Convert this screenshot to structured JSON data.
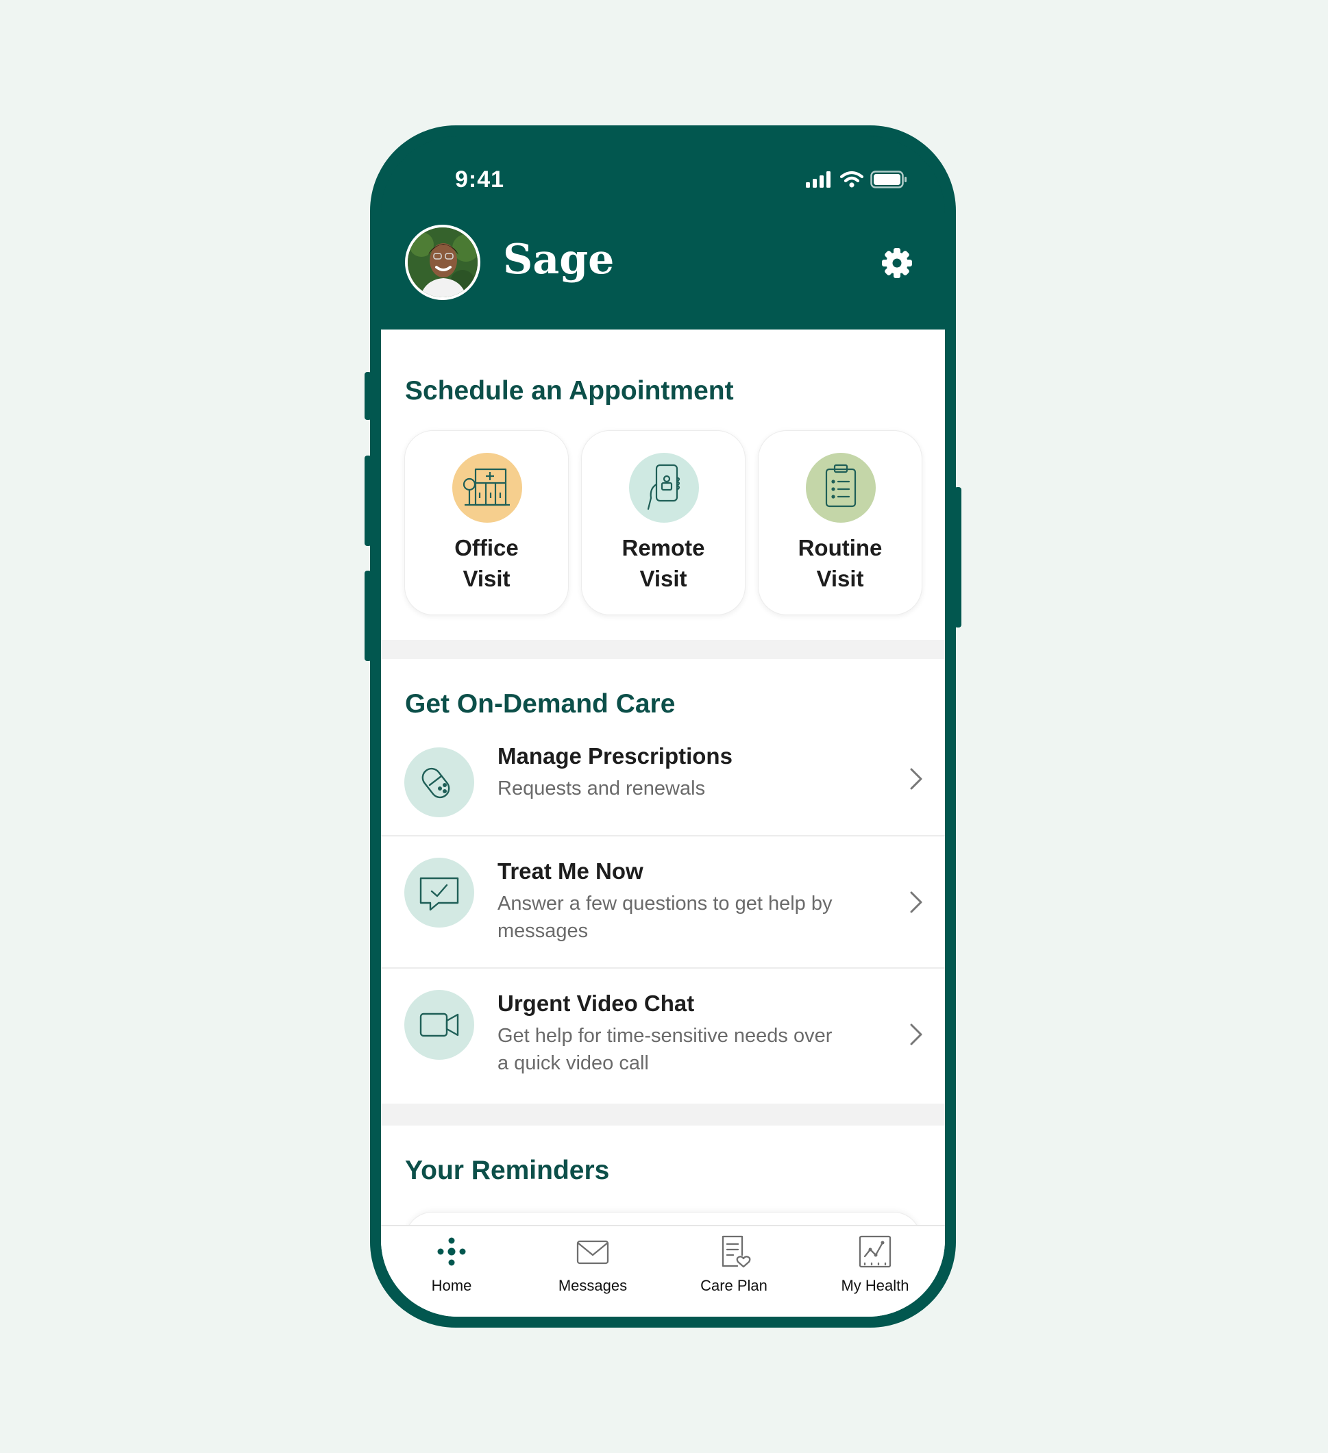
{
  "status_bar": {
    "time": "9:41"
  },
  "header": {
    "title": "Sage",
    "avatar_alt": "user avatar"
  },
  "schedule": {
    "title": "Schedule an Appointment",
    "cards": [
      {
        "label_line1": "Office",
        "label_line2": "Visit",
        "icon": "office-building-icon",
        "icon_bg": "#f6cf8e"
      },
      {
        "label_line1": "Remote",
        "label_line2": "Visit",
        "icon": "phone-hand-icon",
        "icon_bg": "#cfe9e2"
      },
      {
        "label_line1": "Routine",
        "label_line2": "Visit",
        "icon": "clipboard-icon",
        "icon_bg": "#c4d6a8"
      }
    ]
  },
  "on_demand": {
    "title": "Get On-Demand Care",
    "items": [
      {
        "title": "Manage Prescriptions",
        "subtitle": "Requests and renewals",
        "icon": "pill-icon"
      },
      {
        "title": "Treat Me Now",
        "subtitle": "Answer a few questions to get help by messages",
        "icon": "chat-check-icon"
      },
      {
        "title": "Urgent Video Chat",
        "subtitle": "Get help for time-sensitive needs over a quick video call",
        "icon": "video-camera-icon"
      }
    ]
  },
  "reminders": {
    "title": "Your Reminders"
  },
  "tabbar": {
    "tabs": [
      {
        "label": "Home",
        "icon": "home-dots-icon",
        "active": true
      },
      {
        "label": "Messages",
        "icon": "envelope-icon",
        "active": false
      },
      {
        "label": "Care Plan",
        "icon": "care-plan-icon",
        "active": false
      },
      {
        "label": "My Health",
        "icon": "chart-icon",
        "active": false
      }
    ]
  },
  "colors": {
    "brand": "#02574f",
    "heading": "#0c4f49",
    "icon_teal": "#1f6b61",
    "chip_bg": "#d3e9e3"
  }
}
